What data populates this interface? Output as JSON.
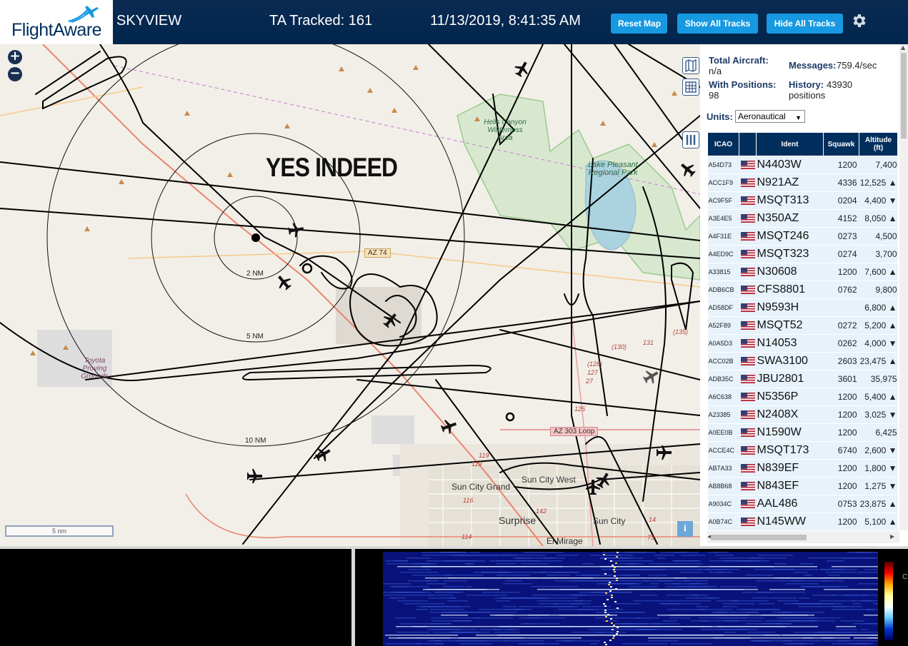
{
  "header": {
    "logo_text": "FlightAware",
    "app_name": "SKYVIEW",
    "tracked": "TA Tracked: 161",
    "datetime": "11/13/2019, 8:41:35 AM",
    "buttons": {
      "reset_map": "Reset Map",
      "show_all": "Show All Tracks",
      "hide_all": "Hide All Tracks"
    },
    "settings_icon": "gear-icon",
    "colors": {
      "bar": "#00264d",
      "button": "#1799e2"
    }
  },
  "map": {
    "zoom_in": "+",
    "zoom_out": "−",
    "overlay_title": "YES INDEED",
    "range_rings": [
      "2 NM",
      "5 NM",
      "10 NM"
    ],
    "highway_shield": "AZ 74",
    "highway_shield_2": "AZ 303 Loop",
    "places": {
      "hells_canyon": "Hells Canyon Wilderness Area",
      "lake_pleasant": "Lake Pleasant Regional Park",
      "toyota": "Toyota Proving Grounds",
      "sun_city_grand": "Sun City Grand",
      "sun_city_west": "Sun City West",
      "surprise": "Surprise",
      "sun_city": "Sun City",
      "el_mirage": "El Mirage"
    },
    "road_numbers": [
      "(130)",
      "(128)",
      "127",
      "27",
      "125",
      "119",
      "119",
      "116",
      "114",
      "142",
      "14",
      "(135)",
      "131",
      "73"
    ],
    "scale": "5 nm",
    "info_button": "i"
  },
  "panel": {
    "total_aircraft_label": "Total Aircraft:",
    "total_aircraft_value": "n/a",
    "messages_label": "Messages:",
    "messages_value": "759.4/sec",
    "with_positions_label": "With Positions:",
    "with_positions_value": "98",
    "history_label": "History:",
    "history_value": "43930 positions",
    "units_label": "Units:",
    "units_value": "Aeronautical",
    "columns": {
      "icao": "ICAO",
      "flag": "",
      "ident": "Ident",
      "squawk": "Squawk",
      "altitude": "Altitude (ft)"
    },
    "rows": [
      {
        "icao": "A54D73",
        "ident": "N4403W",
        "squawk": "1200",
        "alt": "7,400"
      },
      {
        "icao": "ACC1F9",
        "ident": "N921AZ",
        "squawk": "4336",
        "alt": "12,525 ▲"
      },
      {
        "icao": "AC9F5F",
        "ident": "MSQT313",
        "squawk": "0204",
        "alt": "4,400 ▼"
      },
      {
        "icao": "A3E4E5",
        "ident": "N350AZ",
        "squawk": "4152",
        "alt": "8,050 ▲"
      },
      {
        "icao": "A4F31E",
        "ident": "MSQT246",
        "squawk": "0273",
        "alt": "4,500"
      },
      {
        "icao": "A4ED9C",
        "ident": "MSQT323",
        "squawk": "0274",
        "alt": "3,700"
      },
      {
        "icao": "A33815",
        "ident": "N30608",
        "squawk": "1200",
        "alt": "7,600 ▲"
      },
      {
        "icao": "ADB6CB",
        "ident": "CFS8801",
        "squawk": "0762",
        "alt": "9,800"
      },
      {
        "icao": "AD58DF",
        "ident": "N9593H",
        "squawk": "",
        "alt": "6,800 ▲"
      },
      {
        "icao": "A52F89",
        "ident": "MSQT52",
        "squawk": "0272",
        "alt": "5,200 ▲"
      },
      {
        "icao": "A0A5D3",
        "ident": "N14053",
        "squawk": "0262",
        "alt": "4,000 ▼"
      },
      {
        "icao": "ACC02B",
        "ident": "SWA3100",
        "squawk": "2603",
        "alt": "23,475 ▲"
      },
      {
        "icao": "ADB35C",
        "ident": "JBU2801",
        "squawk": "3601",
        "alt": "35,975"
      },
      {
        "icao": "A6C638",
        "ident": "N5356P",
        "squawk": "1200",
        "alt": "5,400 ▲"
      },
      {
        "icao": "A23385",
        "ident": "N2408X",
        "squawk": "1200",
        "alt": "3,025 ▼"
      },
      {
        "icao": "A0EE0B",
        "ident": "N1590W",
        "squawk": "1200",
        "alt": "6,425"
      },
      {
        "icao": "ACCE4C",
        "ident": "MSQT173",
        "squawk": "6740",
        "alt": "2,600 ▼"
      },
      {
        "icao": "AB7A33",
        "ident": "N839EF",
        "squawk": "1200",
        "alt": "1,800 ▼"
      },
      {
        "icao": "AB8B68",
        "ident": "N843EF",
        "squawk": "1200",
        "alt": "1,275 ▼"
      },
      {
        "icao": "A9034C",
        "ident": "AAL486",
        "squawk": "0753",
        "alt": "23,875 ▲"
      },
      {
        "icao": "A0B74C",
        "ident": "N145WW",
        "squawk": "1200",
        "alt": "5,100 ▲"
      }
    ]
  },
  "bottom": {
    "colorbar_label": "C"
  }
}
